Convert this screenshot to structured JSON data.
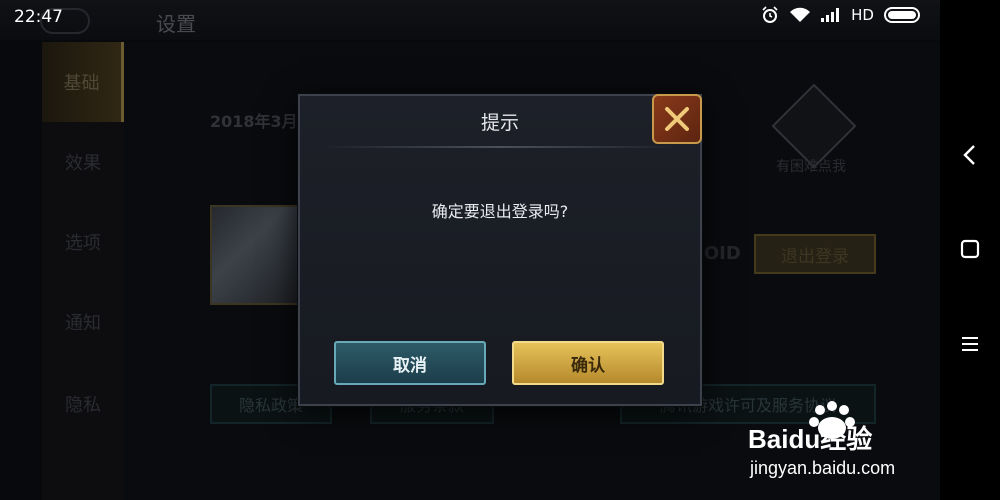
{
  "status_bar": {
    "time": "22:47",
    "network": "HD"
  },
  "header": {
    "title": "设置"
  },
  "sidebar": {
    "items": [
      {
        "label": "基础",
        "active": true
      },
      {
        "label": "效果",
        "active": false
      },
      {
        "label": "选项",
        "active": false
      },
      {
        "label": "通知",
        "active": false
      },
      {
        "label": "隐私",
        "active": false
      }
    ]
  },
  "account": {
    "date": "2018年3月",
    "platform": "ROID",
    "logout_label": "退出登录",
    "support_label": "有困难点我"
  },
  "bottom_buttons": {
    "privacy": "隐私政策",
    "service": "服务条款",
    "license": "腾讯游戏许可及服务协议"
  },
  "dialog": {
    "title": "提示",
    "message": "确定要退出登录吗?",
    "cancel_label": "取消",
    "confirm_label": "确认"
  },
  "watermark": {
    "brand": "Baidu经验",
    "url": "jingyan.baidu.com"
  },
  "colors": {
    "confirm_gold": "#d9b24a",
    "cancel_teal": "#2e5a68",
    "close_orange": "#8a3a1a"
  },
  "icons": [
    "alarm-icon",
    "wifi-icon",
    "signal-icon",
    "battery-icon",
    "close-icon",
    "back-icon",
    "home-icon",
    "menu-icon",
    "support-icon"
  ]
}
